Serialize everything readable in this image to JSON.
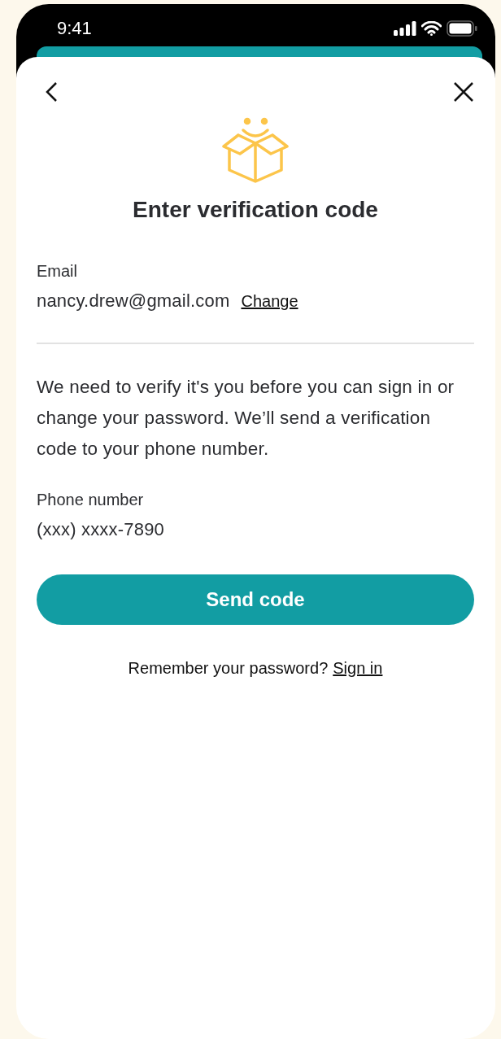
{
  "status_bar": {
    "time": "9:41"
  },
  "title": "Enter verification code",
  "email": {
    "label": "Email",
    "value": "nancy.drew@gmail.com",
    "action": "Change"
  },
  "message": "We need to verify it's you before you can sign in or change your password. We’ll send a verification code to your phone number.",
  "phone": {
    "label": "Phone number",
    "value": "(xxx) xxxx-7890"
  },
  "primary_button": "Send code",
  "footer": {
    "text": "Remember your password?",
    "link": "Sign in"
  }
}
